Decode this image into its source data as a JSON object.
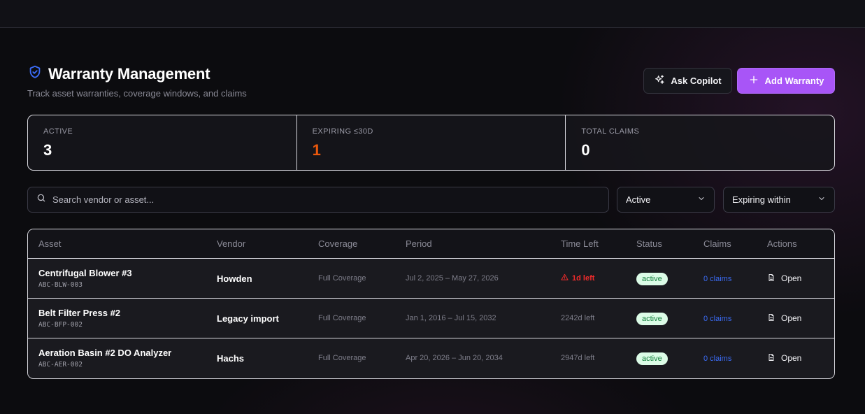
{
  "header": {
    "title": "Warranty Management",
    "subtitle": "Track asset warranties, coverage windows, and claims",
    "copilot_label": "Ask Copilot",
    "add_label": "Add Warranty"
  },
  "stats": [
    {
      "label": "ACTIVE",
      "value": "3",
      "color": "#ffffff"
    },
    {
      "label": "EXPIRING ≤30D",
      "value": "1",
      "color": "#ea580c"
    },
    {
      "label": "TOTAL CLAIMS",
      "value": "0",
      "color": "#ffffff"
    }
  ],
  "filters": {
    "search_placeholder": "Search vendor or asset...",
    "status_value": "Active",
    "expiring_value": "Expiring within"
  },
  "table": {
    "headers": [
      "Asset",
      "Vendor",
      "Coverage",
      "Period",
      "Time Left",
      "Status",
      "Claims",
      "Actions"
    ],
    "rows": [
      {
        "asset": "Centrifugal Blower #3",
        "code": "ABC-BLW-003",
        "vendor": "Howden",
        "coverage": "Full Coverage",
        "period": "Jul 2, 2025 – May 27, 2026",
        "time_left": "1d left",
        "urgent": true,
        "status": "active",
        "claims": "0 claims",
        "action": "Open"
      },
      {
        "asset": "Belt Filter Press #2",
        "code": "ABC-BFP-002",
        "vendor": "Legacy import",
        "coverage": "Full Coverage",
        "period": "Jan 1, 2016 – Jul 15, 2032",
        "time_left": "2242d left",
        "urgent": false,
        "status": "active",
        "claims": "0 claims",
        "action": "Open"
      },
      {
        "asset": "Aeration Basin #2 DO Analyzer",
        "code": "ABC-AER-002",
        "vendor": "Hachs",
        "coverage": "Full Coverage",
        "period": "Apr 20, 2026 – Jun 20, 2034",
        "time_left": "2947d left",
        "urgent": false,
        "status": "active",
        "claims": "0 claims",
        "action": "Open"
      }
    ]
  },
  "colors": {
    "accent": "#a855f7",
    "shield": "#3b6cf6",
    "urgent": "#ef2b2b",
    "badge_bg": "#dcfce7",
    "badge_text": "#15803d",
    "link": "#3b6cf6"
  }
}
